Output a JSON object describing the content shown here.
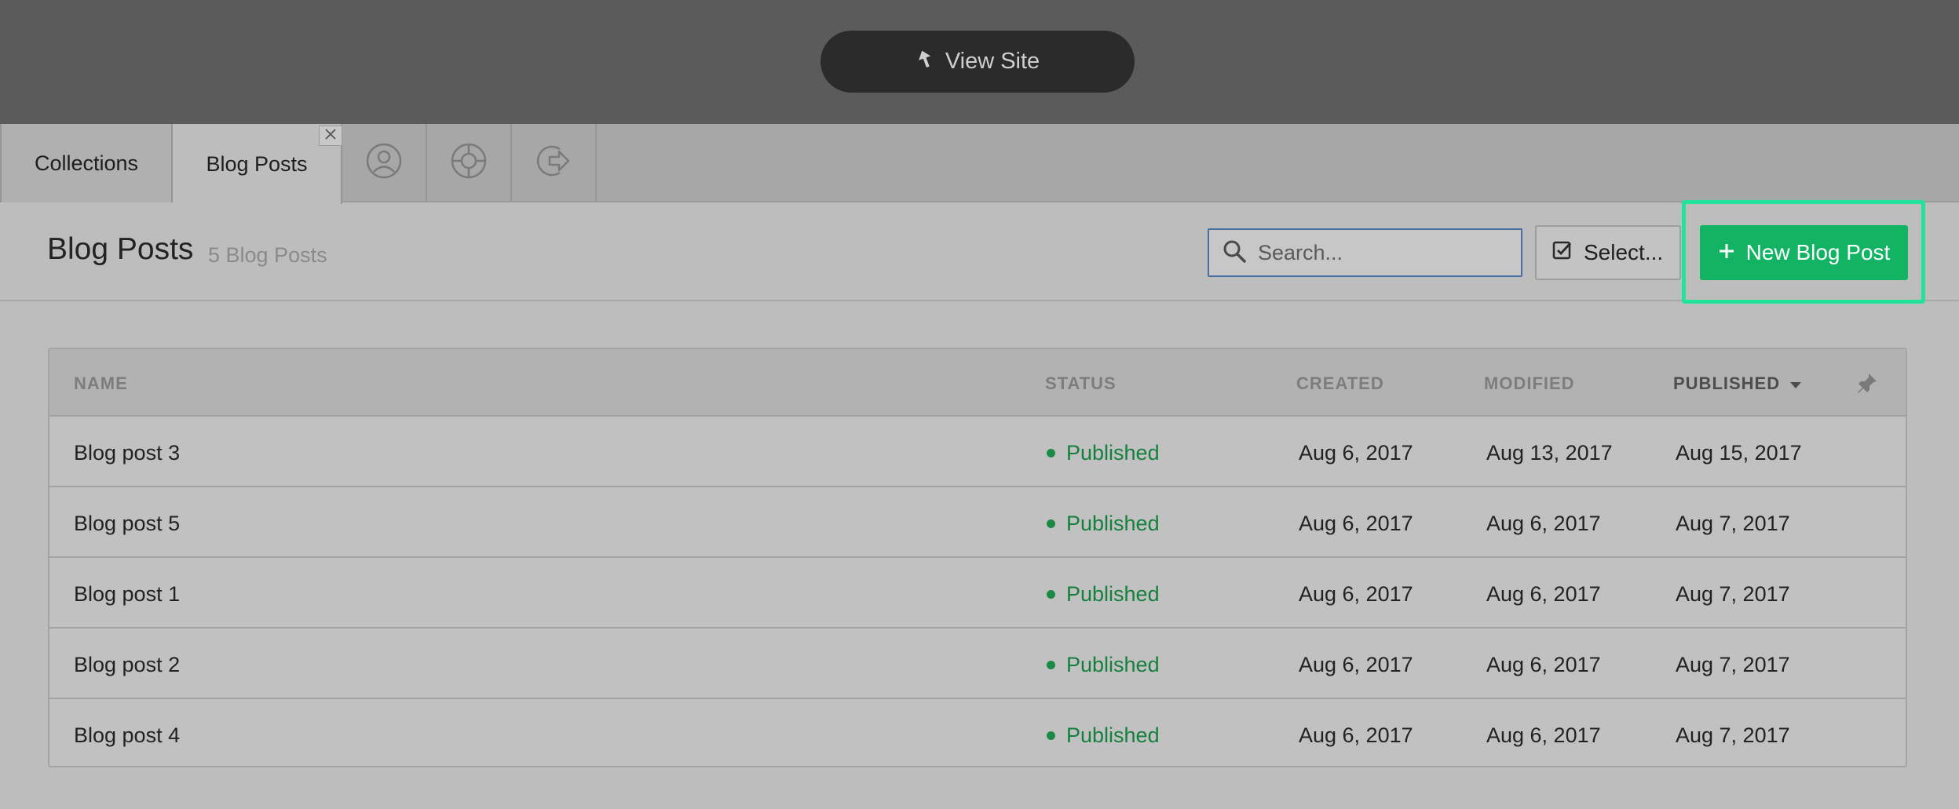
{
  "topbar": {
    "view_site_label": "View Site"
  },
  "tabs": {
    "collections_label": "Collections",
    "blog_posts_label": "Blog Posts",
    "icons": [
      "user-icon",
      "help-lifebuoy-icon",
      "logout-icon"
    ]
  },
  "header": {
    "title": "Blog Posts",
    "count": "5 Blog Posts",
    "search_placeholder": "Search...",
    "select_label": "Select...",
    "new_button_label": "New Blog Post",
    "accent_color": "#13b364",
    "highlight_color": "#22e39a"
  },
  "table": {
    "columns": [
      "NAME",
      "STATUS",
      "CREATED",
      "MODIFIED",
      "PUBLISHED"
    ],
    "rows": [
      {
        "name": "Blog post 3",
        "status": "Published",
        "created": "Aug 6, 2017",
        "modified": "Aug 13, 2017",
        "published": "Aug 15, 2017"
      },
      {
        "name": "Blog post 5",
        "status": "Published",
        "created": "Aug 6, 2017",
        "modified": "Aug 6, 2017",
        "published": "Aug 7, 2017"
      },
      {
        "name": "Blog post 1",
        "status": "Published",
        "created": "Aug 6, 2017",
        "modified": "Aug 6, 2017",
        "published": "Aug 7, 2017"
      },
      {
        "name": "Blog post 2",
        "status": "Published",
        "created": "Aug 6, 2017",
        "modified": "Aug 6, 2017",
        "published": "Aug 7, 2017"
      },
      {
        "name": "Blog post 4",
        "status": "Published",
        "created": "Aug 6, 2017",
        "modified": "Aug 6, 2017",
        "published": "Aug 7, 2017"
      }
    ],
    "status_color": "#15803d"
  }
}
